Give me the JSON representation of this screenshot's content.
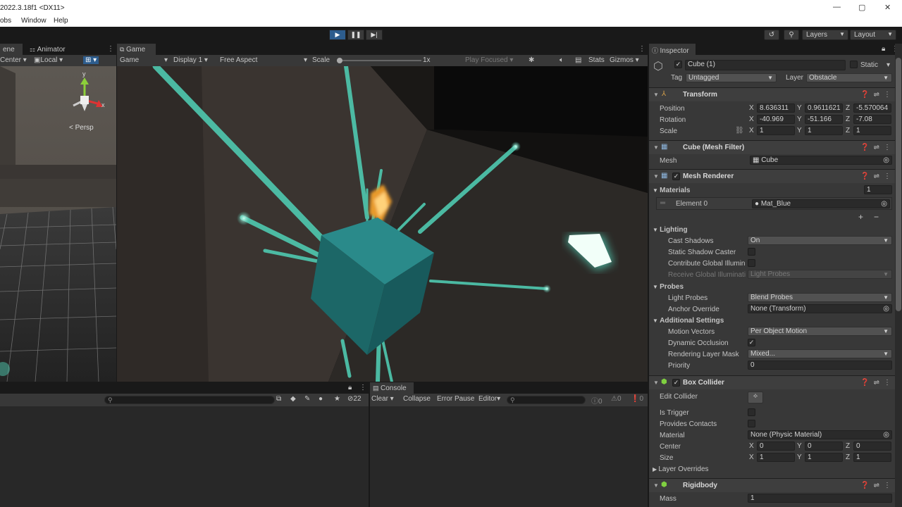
{
  "window": {
    "title": "2022.3.18f1 <DX11>"
  },
  "menu": [
    "obs",
    "Window",
    "Help"
  ],
  "toolbar": {
    "layers_label": "Layers",
    "layout_label": "Layout"
  },
  "scene_panel": {
    "tabs": [
      "ene",
      "Animator"
    ],
    "pivot_label": "Center",
    "space_label": "Local",
    "persp_label": "Persp",
    "gizmo_y": "y",
    "gizmo_x": "x"
  },
  "game_panel": {
    "tab": "Game",
    "view_dropdown": "Game",
    "display": "Display 1",
    "aspect": "Free Aspect",
    "scale_label": "Scale",
    "scale_value": 0.0,
    "scale_text": "1x",
    "play_focused": "Play Focused",
    "stats_label": "Stats",
    "gizmos_label": "Gizmos"
  },
  "hierarchy_panel": {
    "hidden_count": "22"
  },
  "console_panel": {
    "tab": "Console",
    "clear": "Clear",
    "collapse": "Collapse",
    "error_pause": "Error Pause",
    "editor": "Editor",
    "log_count": "0",
    "warn_count": "0",
    "error_count": "0"
  },
  "inspector": {
    "tab": "Inspector",
    "object_name": "Cube (1)",
    "static_label": "Static",
    "tag_label": "Tag",
    "tag_value": "Untagged",
    "layer_label": "Layer",
    "layer_value": "Obstacle",
    "transform": {
      "title": "Transform",
      "position_label": "Position",
      "rotation_label": "Rotation",
      "scale_label": "Scale",
      "position": [
        "8.636311",
        "0.9611621",
        "-5.570064"
      ],
      "rotation": [
        "-40.969",
        "-51.166",
        "-7.08"
      ],
      "scale": [
        "1",
        "1",
        "1"
      ],
      "axes": [
        "X",
        "Y",
        "Z"
      ]
    },
    "mesh_filter": {
      "title": "Cube (Mesh Filter)",
      "mesh_label": "Mesh",
      "mesh_value": "Cube"
    },
    "mesh_renderer": {
      "title": "Mesh Renderer",
      "materials_label": "Materials",
      "materials_count": "1",
      "element_label": "Element 0",
      "element_value": "Mat_Blue",
      "lighting_label": "Lighting",
      "cast_shadows_label": "Cast Shadows",
      "cast_shadows_value": "On",
      "static_shadow_label": "Static Shadow Caster",
      "contribute_gi_label": "Contribute Global Illumin",
      "receive_gi_label": "Receive Global Illuminati",
      "receive_gi_value": "Light Probes",
      "probes_label": "Probes",
      "light_probes_label": "Light Probes",
      "light_probes_value": "Blend Probes",
      "anchor_label": "Anchor Override",
      "anchor_value": "None (Transform)",
      "additional_label": "Additional Settings",
      "motion_vectors_label": "Motion Vectors",
      "motion_vectors_value": "Per Object Motion",
      "dynamic_occlusion_label": "Dynamic Occlusion",
      "rendering_mask_label": "Rendering Layer Mask",
      "rendering_mask_value": "Mixed...",
      "priority_label": "Priority",
      "priority_value": "0"
    },
    "box_collider": {
      "title": "Box Collider",
      "edit_label": "Edit Collider",
      "is_trigger_label": "Is Trigger",
      "provides_contacts_label": "Provides Contacts",
      "material_label": "Material",
      "material_value": "None (Physic Material)",
      "center_label": "Center",
      "center": [
        "0",
        "0",
        "0"
      ],
      "size_label": "Size",
      "size": [
        "1",
        "1",
        "1"
      ],
      "layer_overrides_label": "Layer Overrides"
    },
    "rigidbody": {
      "title": "Rigidbody",
      "mass_label": "Mass",
      "mass_value": "1"
    }
  },
  "colors": {
    "play_active": "#2d5d8e",
    "beam": "#4fc9b0",
    "cube": "#1e6b6b",
    "spark": "#e89a2a"
  }
}
